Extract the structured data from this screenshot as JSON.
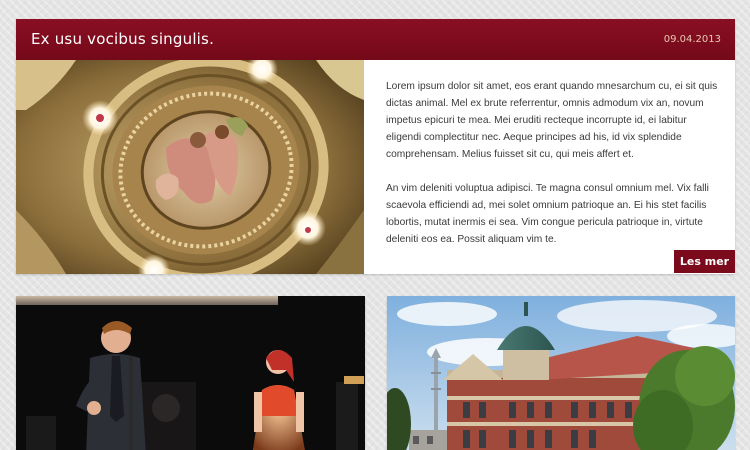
{
  "featured": {
    "title": "Ex usu vocibus singulis.",
    "date": "09.04.2013",
    "image_icon": "ceiling-fresco-photo",
    "paragraphs": [
      "Lorem ipsum dolor sit amet, eos erant quando mnesarchum cu, ei sit quis dictas animal. Mel ex brute referrentur, omnis admodum vix an, novum impetus epicuri te mea. Mei eruditi recteque incorrupte id, ei labitur eligendi complectitur nec. Aeque principes ad his, id vix splendide comprehensam. Melius fuisset sit cu, qui meis affert et.",
      "An vim deleniti voluptua adipisci. Te magna consul omnium mel. Vix falli scaevola efficiendi ad, mei solet omnium patrioque an. Ei his stet facilis lobortis, mutat inermis ei sea. Vim congue pericula patrioque in, virtute deleniti eos ea. Possit aliquam vim te."
    ],
    "read_more_label": "Les mer",
    "accent_color": "#7a0a1c"
  },
  "cards": [
    {
      "image_icon": "concert-stage-photo"
    },
    {
      "image_icon": "historic-building-photo"
    }
  ]
}
